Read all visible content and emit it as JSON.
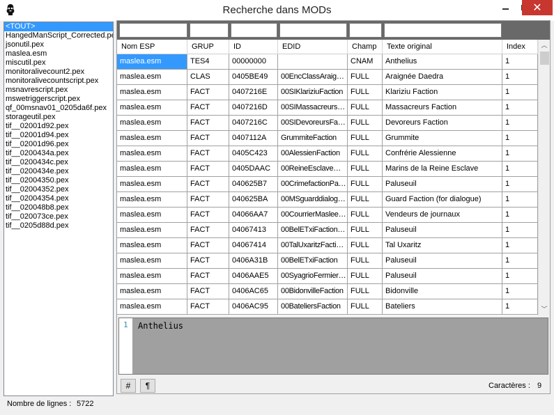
{
  "window": {
    "title": "Recherche dans MODs"
  },
  "file_list": {
    "items": [
      "<TOUT>",
      "HangedManScript_Corrected.pex",
      "jsonutil.pex",
      "maslea.esm",
      "miscutil.pex",
      "monitoralivecount2.pex",
      "monitoralivecountscript.pex",
      "msnavrescript.pex",
      "mswetriggerscript.pex",
      "qf_00msnav01_0205da6f.pex",
      "storageutil.pex",
      "tif__02001d92.pex",
      "tif__02001d94.pex",
      "tif__02001d96.pex",
      "tif__0200434a.pex",
      "tif__0200434c.pex",
      "tif__0200434e.pex",
      "tif__02004350.pex",
      "tif__02004352.pex",
      "tif__02004354.pex",
      "tif__020048b8.pex",
      "tif__020073ce.pex",
      "tif__0205d88d.pex"
    ]
  },
  "grid": {
    "columns": [
      "Nom ESP",
      "GRUP",
      "ID",
      "EDID",
      "Champ",
      "Texte original",
      "Index"
    ],
    "rows": [
      [
        "maslea.esm",
        "TES4",
        "00000000",
        "",
        "CNAM",
        "Anthelius",
        "1"
      ],
      [
        "maslea.esm",
        "CLAS",
        "0405BE49",
        "00EncClassAraig…",
        "FULL",
        "Araignée Daedra",
        "1"
      ],
      [
        "maslea.esm",
        "FACT",
        "0407216E",
        "00SIKlariziuFaction",
        "FULL",
        "Klariziu Faction",
        "1"
      ],
      [
        "maslea.esm",
        "FACT",
        "0407216D",
        "00SIMassacreurs…",
        "FULL",
        "Massacreurs Faction",
        "1"
      ],
      [
        "maslea.esm",
        "FACT",
        "0407216C",
        "00SIDevoreursFa…",
        "FULL",
        "Devoreurs Faction",
        "1"
      ],
      [
        "maslea.esm",
        "FACT",
        "0407112A",
        "GrummiteFaction",
        "FULL",
        "Grummite",
        "1"
      ],
      [
        "maslea.esm",
        "FACT",
        "0405C423",
        "00AlessienFaction",
        "FULL",
        "Confrérie Alessienne",
        "1"
      ],
      [
        "maslea.esm",
        "FACT",
        "0405DAAC",
        "00ReineEsclave…",
        "FULL",
        "Marins de la Reine Esclave",
        "1"
      ],
      [
        "maslea.esm",
        "FACT",
        "040625B7",
        "00CrimefactionPa…",
        "FULL",
        "Paluseuil",
        "1"
      ],
      [
        "maslea.esm",
        "FACT",
        "040625BA",
        "00MSguarddialog…",
        "FULL",
        "Guard Faction (for dialogue)",
        "1"
      ],
      [
        "maslea.esm",
        "FACT",
        "04066AA7",
        "00CourrierMaslee…",
        "FULL",
        "Vendeurs de journaux",
        "1"
      ],
      [
        "maslea.esm",
        "FACT",
        "04067413",
        "00BelETxiFaction…",
        "FULL",
        "Paluseuil",
        "1"
      ],
      [
        "maslea.esm",
        "FACT",
        "04067414",
        "00TalUxaritzFacti…",
        "FULL",
        "Tal Uxaritz",
        "1"
      ],
      [
        "maslea.esm",
        "FACT",
        "0406A31B",
        "00BelETxiFaction",
        "FULL",
        "Paluseuil",
        "1"
      ],
      [
        "maslea.esm",
        "FACT",
        "0406AAE5",
        "00SyagrioFermier…",
        "FULL",
        "Paluseuil",
        "1"
      ],
      [
        "maslea.esm",
        "FACT",
        "0406AC65",
        "00BidonvilleFaction",
        "FULL",
        "Bidonville",
        "1"
      ],
      [
        "maslea.esm",
        "FACT",
        "0406AC95",
        "00BateliersFaction",
        "FULL",
        "Bateliers",
        "1"
      ]
    ]
  },
  "editor": {
    "line_number": "1",
    "text": "Anthelius"
  },
  "toolbar": {
    "hash_label": "#",
    "pilcrow_label": "¶"
  },
  "chars": {
    "label": "Caractères :",
    "value": "9"
  },
  "status": {
    "label": "Nombre de lignes :",
    "value": "5722"
  },
  "colors": {
    "selection": "#3399ff",
    "close_button": "#c7372f",
    "filter_bar": "#696969",
    "editor_bg": "#a0a0a0"
  }
}
